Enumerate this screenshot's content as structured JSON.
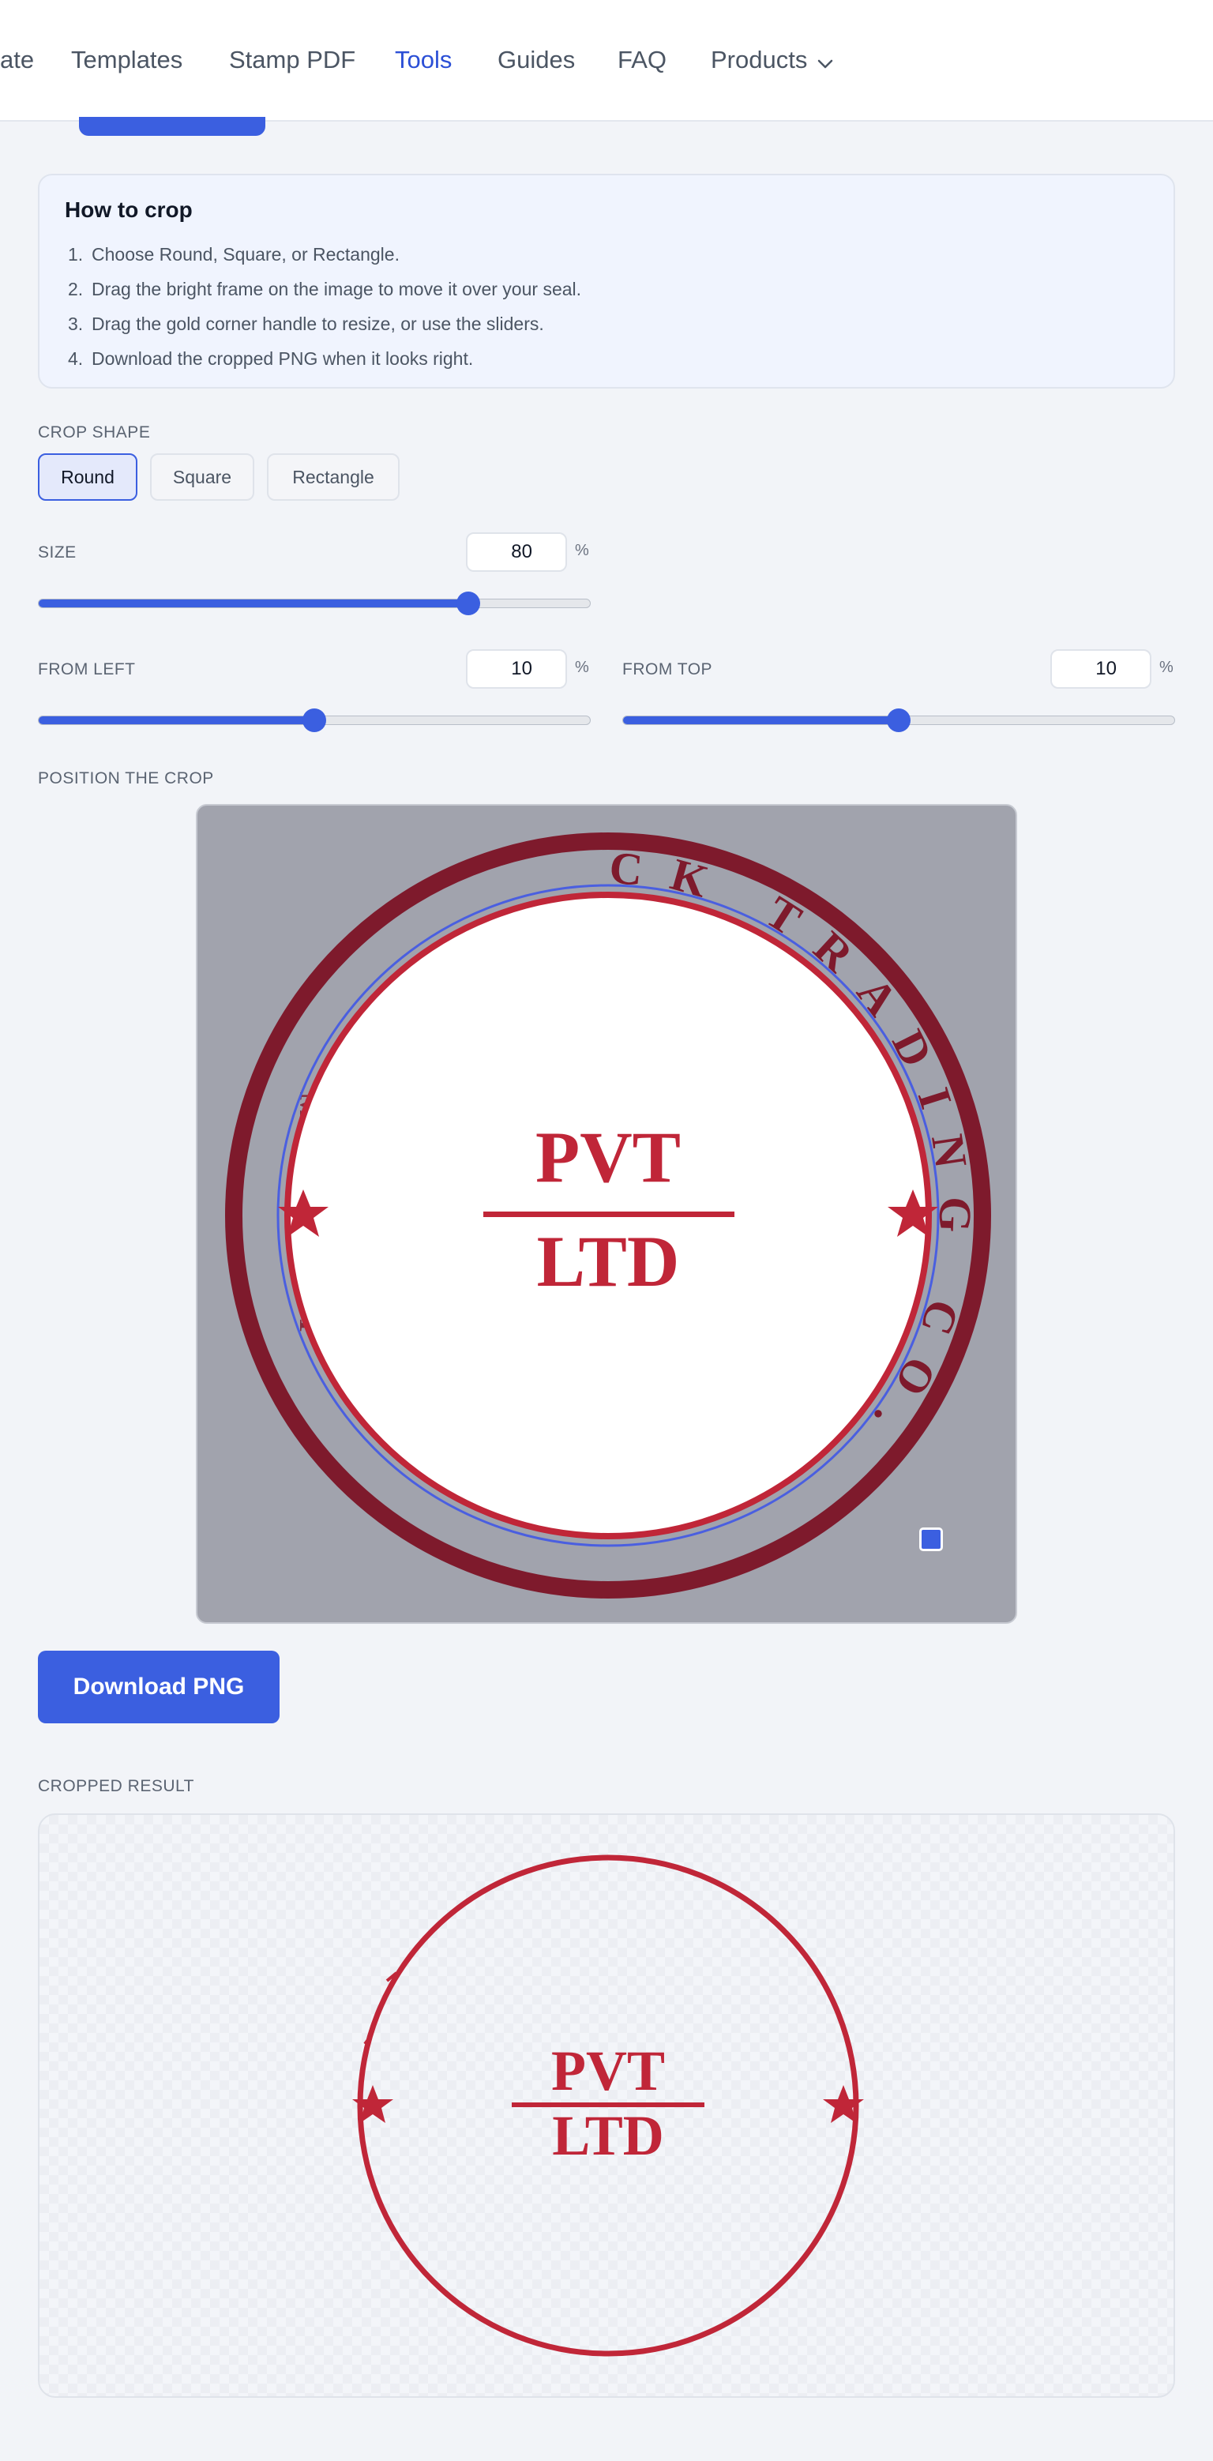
{
  "nav": {
    "items": [
      "ate",
      "Templates",
      "Stamp PDF",
      "Tools",
      "Guides",
      "FAQ",
      "Products"
    ],
    "active": "Tools"
  },
  "howto": {
    "title": "How to crop",
    "steps": [
      "Choose Round, Square, or Rectangle.",
      "Drag the bright frame on the image to move it over your seal.",
      "Drag the gold corner handle to resize, or use the sliders.",
      "Download the cropped PNG when it looks right."
    ]
  },
  "crop_shape": {
    "label": "CROP SHAPE",
    "options": [
      "Round",
      "Square",
      "Rectangle"
    ],
    "selected": "Round"
  },
  "size": {
    "label": "SIZE",
    "value": "80",
    "unit": "%"
  },
  "from_left": {
    "label": "FROM LEFT",
    "value": "10",
    "unit": "%"
  },
  "from_top": {
    "label": "FROM TOP",
    "value": "10",
    "unit": "%"
  },
  "slider_levels": {
    "size": 0.78,
    "from_left": 0.5,
    "from_top": 0.5
  },
  "position_label": "POSITION THE CROP",
  "seal": {
    "ring_text": "...CK TRADING CO.",
    "center_top": "PVT",
    "center_bottom": "LTD",
    "color": "#c02638"
  },
  "download_label": "Download PNG",
  "result_label": "CROPPED RESULT",
  "colors": {
    "accent": "#3b5fe0"
  }
}
